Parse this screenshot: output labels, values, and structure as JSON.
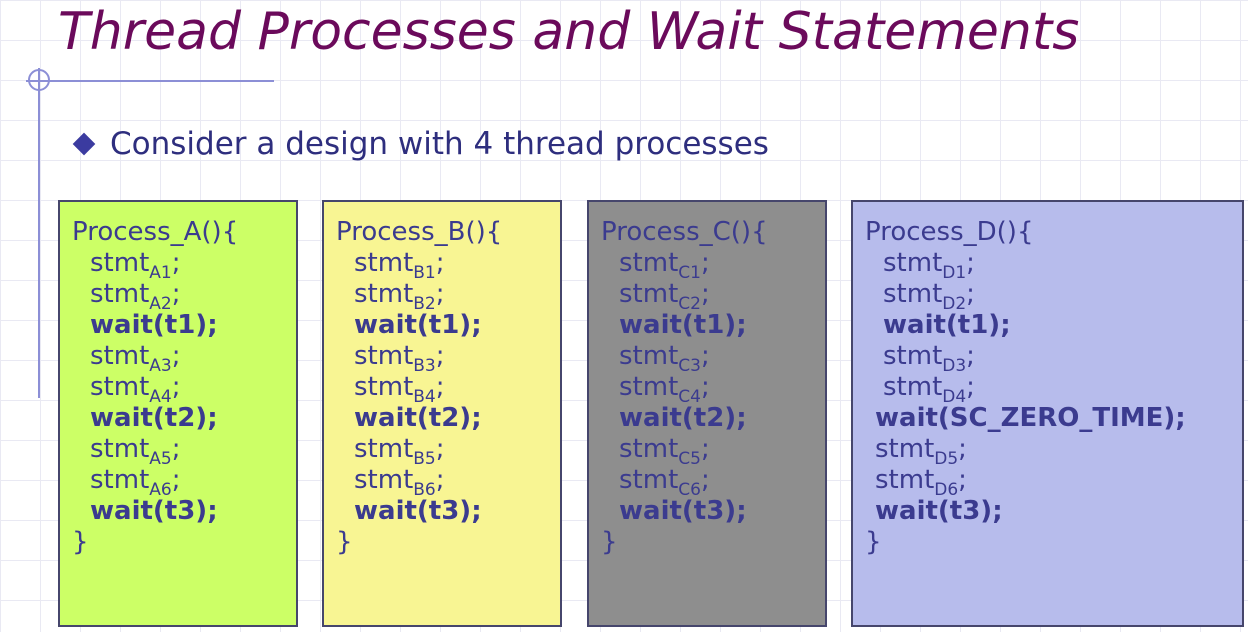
{
  "slide": {
    "title": "Thread Processes and Wait Statements",
    "bullet": "Consider a design with 4 thread processes"
  },
  "processes": [
    {
      "header": "Process_A(){",
      "stmt_word": "stmt",
      "semicolon": ";",
      "close": "}",
      "lines": [
        {
          "sub": "A1"
        },
        {
          "sub": "A2"
        },
        {
          "wait": "wait(t1);"
        },
        {
          "sub": "A3"
        },
        {
          "sub": "A4"
        },
        {
          "wait": "wait(t2);"
        },
        {
          "sub": "A5"
        },
        {
          "sub": "A6"
        },
        {
          "wait": "wait(t3);"
        }
      ],
      "box_color": "#ccff66"
    },
    {
      "header": "Process_B(){",
      "stmt_word": "stmt",
      "semicolon": ";",
      "close": "}",
      "lines": [
        {
          "sub": "B1"
        },
        {
          "sub": "B2"
        },
        {
          "wait": "wait(t1);"
        },
        {
          "sub": "B3"
        },
        {
          "sub": "B4"
        },
        {
          "wait": "wait(t2);"
        },
        {
          "sub": "B5"
        },
        {
          "sub": "B6"
        },
        {
          "wait": "wait(t3);"
        }
      ],
      "box_color": "#f8f593"
    },
    {
      "header": "Process_C(){",
      "stmt_word": "stmt",
      "semicolon": ";",
      "close": "}",
      "lines": [
        {
          "sub": "C1"
        },
        {
          "sub": "C2"
        },
        {
          "wait": "wait(t1);"
        },
        {
          "sub": "C3"
        },
        {
          "sub": "C4"
        },
        {
          "wait": "wait(t2);"
        },
        {
          "sub": "C5"
        },
        {
          "sub": "C6"
        },
        {
          "wait": "wait(t3);"
        }
      ],
      "box_color": "#8e8e8e"
    },
    {
      "header": "Process_D(){",
      "stmt_word": "stmt",
      "semicolon": ";",
      "close": "}",
      "lines": [
        {
          "sub": "D1"
        },
        {
          "sub": "D2"
        },
        {
          "wait": "wait(t1);"
        },
        {
          "sub": "D3"
        },
        {
          "sub": "D4"
        },
        {
          "wait": "wait(SC_ZERO_TIME);"
        },
        {
          "sub": "D5"
        },
        {
          "sub": "D6"
        },
        {
          "wait": "wait(t3);"
        }
      ],
      "box_color": "#b7bcec"
    }
  ],
  "colors": {
    "title": "#6b0a5b",
    "text": "#3b3b8f",
    "accent_lines": "#8c8fd6",
    "bullet": "#3b3ba0"
  },
  "icons": {
    "bullet": "diamond-bullet-icon",
    "title_ornament": "circle-ornament-icon"
  }
}
